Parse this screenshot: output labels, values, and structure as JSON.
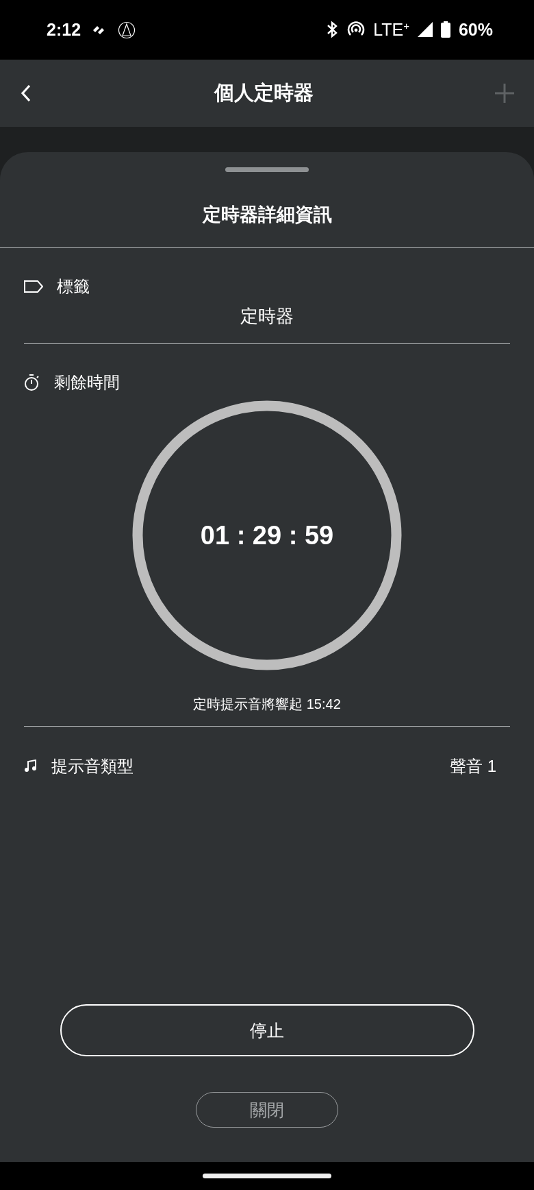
{
  "status_bar": {
    "time": "2:12",
    "network": "LTE$^{+}$",
    "battery": "60%"
  },
  "header": {
    "title": "個人定時器"
  },
  "sheet": {
    "title": "定時器詳細資訊",
    "label_row": {
      "label": "標籤",
      "value": "定時器"
    },
    "remaining_row": {
      "label": "剩餘時間",
      "countdown": "01 : 29 : 59",
      "alarm_note": "定時提示音將響起 15:42"
    },
    "sound_row": {
      "label": "提示音類型",
      "value": "聲音 1"
    },
    "buttons": [
      {
        "label": "停止",
        "kind": "primary"
      },
      {
        "label": "關閉",
        "kind": "secondary"
      }
    ]
  }
}
